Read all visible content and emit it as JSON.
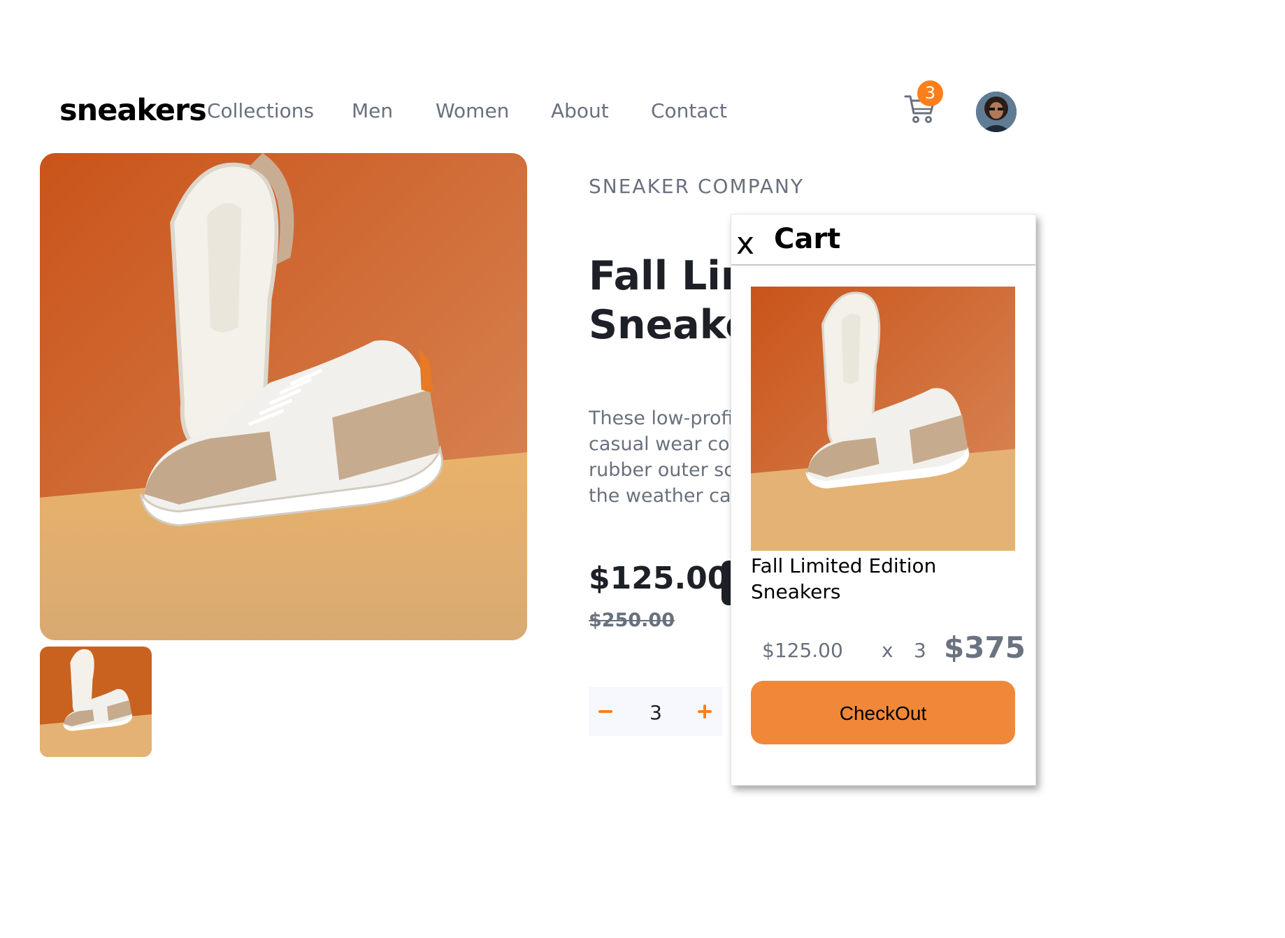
{
  "brand": {
    "logo": "sneakers"
  },
  "nav": {
    "items": [
      "Collections",
      "Men",
      "Women",
      "About",
      "Contact"
    ]
  },
  "header": {
    "cart_count": "3",
    "cart_icon": "cart-icon",
    "avatar_icon": "user-avatar"
  },
  "product": {
    "company": "SNEAKER COMPANY",
    "title_line1": "Fall Limited Edition",
    "title_line2": "Sneakers",
    "desc_lines": [
      "These low-profile sneakers are your perfect",
      "casual wear companion. Featuring a durable",
      "rubber outer sole, they'll withstand everything",
      "the weather can offer."
    ],
    "price": "$125.00",
    "old_price": "$250.00",
    "quantity": "3"
  },
  "cart": {
    "close_label": "x",
    "heading": "Cart",
    "item_name": "Fall Limited Edition Sneakers",
    "unit_price": "$125.00",
    "times": "x",
    "count": "3",
    "total": "$375",
    "checkout_label": "CheckOut"
  },
  "colors": {
    "accent": "#ff7e1b",
    "checkout": "#f0883a",
    "dark": "#1d2026",
    "muted": "#69707d"
  }
}
